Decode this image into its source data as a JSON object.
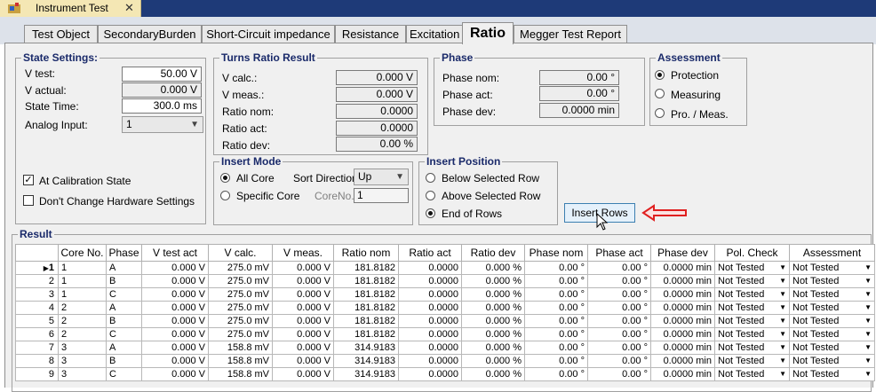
{
  "window": {
    "title": "Instrument Test",
    "close_glyph": "✕"
  },
  "tabs": [
    {
      "label": "Test Object",
      "active": false
    },
    {
      "label": "SecondaryBurden",
      "active": false
    },
    {
      "label": "Short-Circuit impedance",
      "active": false
    },
    {
      "label": "Resistance",
      "active": false
    },
    {
      "label": "Excitation",
      "active": false
    },
    {
      "label": "Ratio",
      "active": true
    },
    {
      "label": "Megger Test Report",
      "active": false
    }
  ],
  "state_settings": {
    "title": "State Settings:",
    "v_test_label": "V test:",
    "v_test_value": "50.00 V",
    "v_actual_label": "V actual:",
    "v_actual_value": "0.000 V",
    "state_time_label": "State Time:",
    "state_time_value": "300.0 ms",
    "analog_input_label": "Analog Input:",
    "analog_input_value": "1",
    "at_calibration_label": "At Calibration State",
    "at_calibration_checked": true,
    "dont_change_label": "Don't Change Hardware Settings",
    "dont_change_checked": false
  },
  "turns_ratio": {
    "title": "Turns Ratio Result",
    "v_calc_label": "V calc.:",
    "v_calc_value": "0.000 V",
    "v_meas_label": "V meas.:",
    "v_meas_value": "0.000 V",
    "ratio_nom_label": "Ratio nom:",
    "ratio_nom_value": "0.0000",
    "ratio_act_label": "Ratio act:",
    "ratio_act_value": "0.0000",
    "ratio_dev_label": "Ratio dev:",
    "ratio_dev_value": "0.00 %"
  },
  "phase": {
    "title": "Phase",
    "phase_nom_label": "Phase nom:",
    "phase_nom_value": "0.00 °",
    "phase_act_label": "Phase act:",
    "phase_act_value": "0.00 °",
    "phase_dev_label": "Phase dev:",
    "phase_dev_value": "0.0000 min"
  },
  "assessment": {
    "title": "Assessment",
    "options": [
      {
        "label": "Protection",
        "selected": true
      },
      {
        "label": "Measuring",
        "selected": false
      },
      {
        "label": "Pro. / Meas.",
        "selected": false
      }
    ]
  },
  "insert_mode": {
    "title": "Insert Mode",
    "all_core_label": "All Core",
    "all_core_selected": true,
    "specific_core_label": "Specific Core",
    "specific_core_selected": false,
    "sort_direction_label": "Sort Direction",
    "sort_direction_value": "Up",
    "core_no_label": "CoreNo.",
    "core_no_value": "1"
  },
  "insert_position": {
    "title": "Insert Position",
    "options": [
      {
        "label": "Below Selected Row",
        "selected": false
      },
      {
        "label": "Above Selected Row",
        "selected": false
      },
      {
        "label": "End of Rows",
        "selected": true
      }
    ]
  },
  "insert_rows_label": "Insert Rows",
  "result": {
    "title": "Result",
    "columns": [
      "Core No.",
      "Phase",
      "V test act",
      "V calc.",
      "V meas.",
      "Ratio nom",
      "Ratio act",
      "Ratio dev",
      "Phase nom",
      "Phase act",
      "Phase dev",
      "Pol. Check",
      "Assessment"
    ],
    "rows": [
      {
        "n": "1",
        "core": "1",
        "phase": "A",
        "vtest": "0.000 V",
        "vcalc": "275.0 mV",
        "vmeas": "0.000 V",
        "rnom": "181.8182",
        "ract": "0.0000",
        "rdev": "0.000 %",
        "pnom": "0.00 °",
        "pact": "0.00 °",
        "pdev": "0.0000 min",
        "pol": "Not Tested",
        "assess": "Not Tested"
      },
      {
        "n": "2",
        "core": "1",
        "phase": "B",
        "vtest": "0.000 V",
        "vcalc": "275.0 mV",
        "vmeas": "0.000 V",
        "rnom": "181.8182",
        "ract": "0.0000",
        "rdev": "0.000 %",
        "pnom": "0.00 °",
        "pact": "0.00 °",
        "pdev": "0.0000 min",
        "pol": "Not Tested",
        "assess": "Not Tested"
      },
      {
        "n": "3",
        "core": "1",
        "phase": "C",
        "vtest": "0.000 V",
        "vcalc": "275.0 mV",
        "vmeas": "0.000 V",
        "rnom": "181.8182",
        "ract": "0.0000",
        "rdev": "0.000 %",
        "pnom": "0.00 °",
        "pact": "0.00 °",
        "pdev": "0.0000 min",
        "pol": "Not Tested",
        "assess": "Not Tested"
      },
      {
        "n": "4",
        "core": "2",
        "phase": "A",
        "vtest": "0.000 V",
        "vcalc": "275.0 mV",
        "vmeas": "0.000 V",
        "rnom": "181.8182",
        "ract": "0.0000",
        "rdev": "0.000 %",
        "pnom": "0.00 °",
        "pact": "0.00 °",
        "pdev": "0.0000 min",
        "pol": "Not Tested",
        "assess": "Not Tested"
      },
      {
        "n": "5",
        "core": "2",
        "phase": "B",
        "vtest": "0.000 V",
        "vcalc": "275.0 mV",
        "vmeas": "0.000 V",
        "rnom": "181.8182",
        "ract": "0.0000",
        "rdev": "0.000 %",
        "pnom": "0.00 °",
        "pact": "0.00 °",
        "pdev": "0.0000 min",
        "pol": "Not Tested",
        "assess": "Not Tested"
      },
      {
        "n": "6",
        "core": "2",
        "phase": "C",
        "vtest": "0.000 V",
        "vcalc": "275.0 mV",
        "vmeas": "0.000 V",
        "rnom": "181.8182",
        "ract": "0.0000",
        "rdev": "0.000 %",
        "pnom": "0.00 °",
        "pact": "0.00 °",
        "pdev": "0.0000 min",
        "pol": "Not Tested",
        "assess": "Not Tested"
      },
      {
        "n": "7",
        "core": "3",
        "phase": "A",
        "vtest": "0.000 V",
        "vcalc": "158.8 mV",
        "vmeas": "0.000 V",
        "rnom": "314.9183",
        "ract": "0.0000",
        "rdev": "0.000 %",
        "pnom": "0.00 °",
        "pact": "0.00 °",
        "pdev": "0.0000 min",
        "pol": "Not Tested",
        "assess": "Not Tested"
      },
      {
        "n": "8",
        "core": "3",
        "phase": "B",
        "vtest": "0.000 V",
        "vcalc": "158.8 mV",
        "vmeas": "0.000 V",
        "rnom": "314.9183",
        "ract": "0.0000",
        "rdev": "0.000 %",
        "pnom": "0.00 °",
        "pact": "0.00 °",
        "pdev": "0.0000 min",
        "pol": "Not Tested",
        "assess": "Not Tested"
      },
      {
        "n": "9",
        "core": "3",
        "phase": "C",
        "vtest": "0.000 V",
        "vcalc": "158.8 mV",
        "vmeas": "0.000 V",
        "rnom": "314.9183",
        "ract": "0.0000",
        "rdev": "0.000 %",
        "pnom": "0.00 °",
        "pact": "0.00 °",
        "pdev": "0.0000 min",
        "pol": "Not Tested",
        "assess": "Not Tested"
      }
    ]
  },
  "colors": {
    "title_bar": "#1e3a78",
    "active_doc_tab": "#f4e7b4",
    "group_title": "#1a2a6a",
    "arrow": "#e02020",
    "button_border": "#3c7fb1"
  },
  "icons": {
    "doc_icon": "instrument-icon",
    "row_pointer": "row-pointer-icon",
    "arrow": "red-arrow-icon",
    "cursor": "mouse-cursor-icon"
  }
}
